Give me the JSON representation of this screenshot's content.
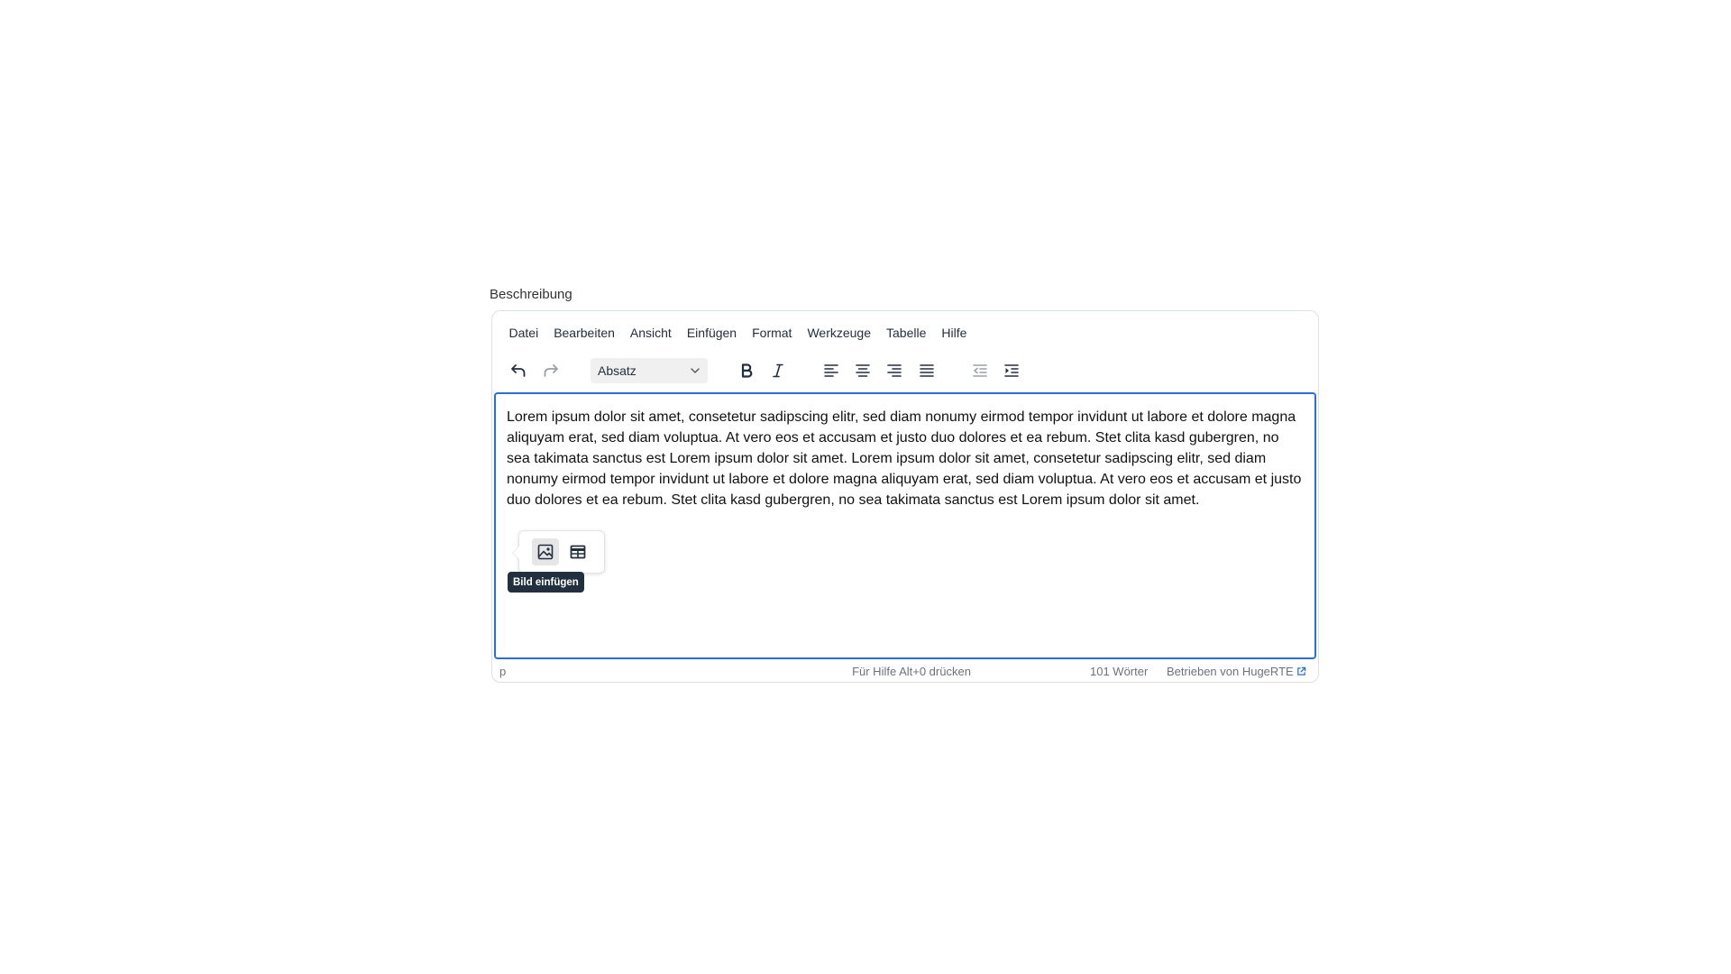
{
  "field": {
    "label": "Beschreibung"
  },
  "menubar": {
    "items": [
      "Datei",
      "Bearbeiten",
      "Ansicht",
      "Einfügen",
      "Format",
      "Werkzeuge",
      "Tabelle",
      "Hilfe"
    ]
  },
  "toolbar": {
    "block_format_value": "Absatz",
    "buttons": {
      "undo": "undo-icon",
      "redo": "redo-icon",
      "bold": "bold-icon",
      "italic": "italic-icon",
      "align_left": "align-left-icon",
      "align_center": "align-center-icon",
      "align_right": "align-right-icon",
      "align_justify": "align-justify-icon",
      "outdent": "outdent-icon",
      "indent": "indent-icon"
    }
  },
  "content": {
    "text": "Lorem ipsum dolor sit amet, consetetur sadipscing elitr, sed diam nonumy eirmod tempor invidunt ut labore et dolore magna aliquyam erat, sed diam voluptua. At vero eos et accusam et justo duo dolores et ea rebum. Stet clita kasd gubergren, no sea takimata sanctus est Lorem ipsum dolor sit amet. Lorem ipsum dolor sit amet, consetetur sadipscing elitr, sed diam nonumy eirmod tempor invidunt ut labore et dolore magna aliquyam erat, sed diam voluptua. At vero eos et accusam et justo duo dolores et ea rebum. Stet clita kasd gubergren, no sea takimata sanctus est Lorem ipsum dolor sit amet."
  },
  "quick_toolbar": {
    "buttons": [
      "image-icon",
      "table-icon"
    ],
    "tooltip": "Bild einfügen"
  },
  "statusbar": {
    "path": "p",
    "help": "Für Hilfe Alt+0 drücken",
    "word_count": "101 Wörter",
    "branding": "Betrieben von HugeRTE"
  },
  "colors": {
    "focus_border": "#2b6fd6",
    "text": "#222f3e",
    "link_icon": "#2b6fd6"
  }
}
